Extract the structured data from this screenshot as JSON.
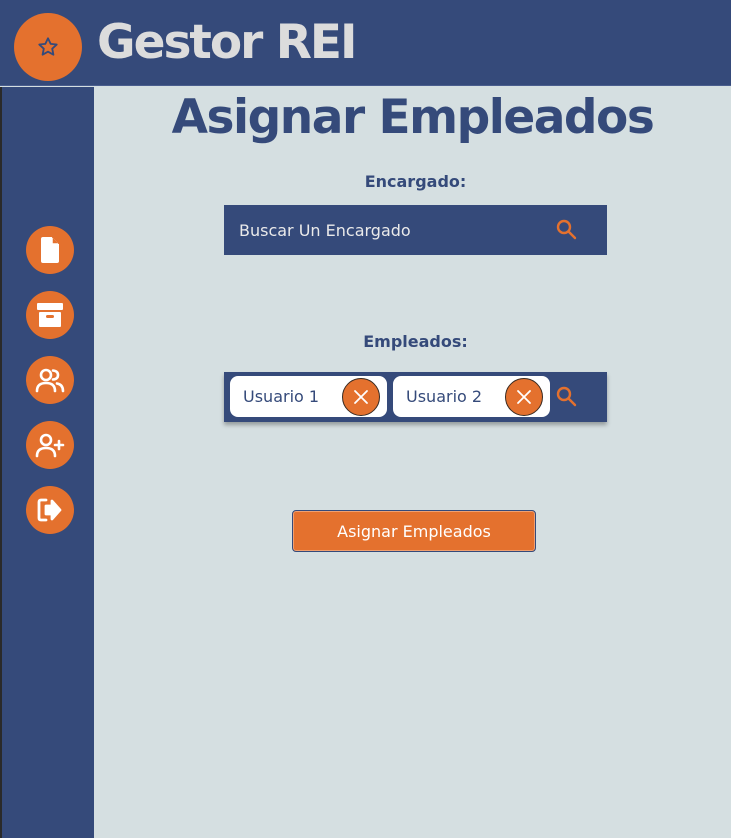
{
  "app": {
    "title": "Gestor REI",
    "logo_icon": "star-icon"
  },
  "sidebar": {
    "items": [
      {
        "icon": "document-icon"
      },
      {
        "icon": "archive-icon"
      },
      {
        "icon": "users-icon"
      },
      {
        "icon": "add-user-icon"
      },
      {
        "icon": "logout-icon"
      }
    ]
  },
  "page": {
    "title": "Asignar Empleados"
  },
  "encargado": {
    "label": "Encargado:",
    "placeholder": "Buscar Un Encargado",
    "value": ""
  },
  "empleados": {
    "label": "Empleados:",
    "tags": [
      {
        "label": "Usuario 1"
      },
      {
        "label": "Usuario 2"
      }
    ]
  },
  "actions": {
    "submit_label": "Asignar Empleados"
  },
  "colors": {
    "primary": "#354a7a",
    "accent": "#e4712e",
    "background": "#d5dfe1",
    "header_text": "#dcdcdc"
  }
}
